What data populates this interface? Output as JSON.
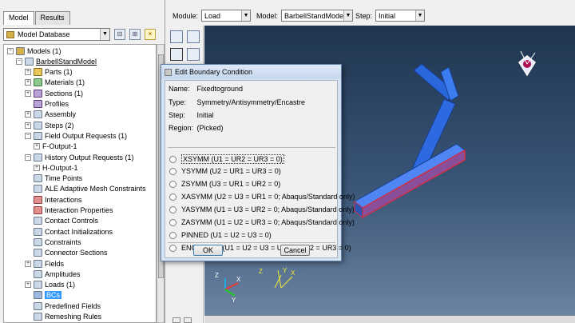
{
  "tabs": [
    "Model",
    "Results"
  ],
  "model_db": {
    "label": "Model Database"
  },
  "tree": [
    {
      "text": "Models (1)",
      "indent": 0,
      "icon": "db",
      "exp": "-"
    },
    {
      "text": "BarbellStandModel",
      "indent": 1,
      "icon": "",
      "exp": "-",
      "u": true
    },
    {
      "text": "Parts (1)",
      "indent": 2,
      "icon": "yellow",
      "exp": "+"
    },
    {
      "text": "Materials (1)",
      "indent": 2,
      "icon": "green",
      "exp": "+"
    },
    {
      "text": "Sections (1)",
      "indent": 2,
      "icon": "purple",
      "exp": "+"
    },
    {
      "text": "Profiles",
      "indent": 2,
      "icon": "purple",
      "exp": ""
    },
    {
      "text": "Assembly",
      "indent": 2,
      "icon": "",
      "exp": "+"
    },
    {
      "text": "Steps (2)",
      "indent": 2,
      "icon": "",
      "exp": "+"
    },
    {
      "text": "Field Output Requests (1)",
      "indent": 2,
      "icon": "",
      "exp": "-"
    },
    {
      "text": "F-Output-1",
      "indent": 3,
      "icon": "none",
      "exp": "+"
    },
    {
      "text": "History Output Requests (1)",
      "indent": 2,
      "icon": "",
      "exp": "-"
    },
    {
      "text": "H-Output-1",
      "indent": 3,
      "icon": "none",
      "exp": "+"
    },
    {
      "text": "Time Points",
      "indent": 2,
      "icon": "",
      "exp": ""
    },
    {
      "text": "ALE Adaptive Mesh Constraints",
      "indent": 2,
      "icon": "",
      "exp": ""
    },
    {
      "text": "Interactions",
      "indent": 2,
      "icon": "red",
      "exp": ""
    },
    {
      "text": "Interaction Properties",
      "indent": 2,
      "icon": "red",
      "exp": ""
    },
    {
      "text": "Contact Controls",
      "indent": 2,
      "icon": "",
      "exp": ""
    },
    {
      "text": "Contact Initializations",
      "indent": 2,
      "icon": "",
      "exp": ""
    },
    {
      "text": "Constraints",
      "indent": 2,
      "icon": "",
      "exp": ""
    },
    {
      "text": "Connector Sections",
      "indent": 2,
      "icon": "",
      "exp": ""
    },
    {
      "text": "Fields",
      "indent": 2,
      "icon": "",
      "exp": "+"
    },
    {
      "text": "Amplitudes",
      "indent": 2,
      "icon": "",
      "exp": ""
    },
    {
      "text": "Loads (1)",
      "indent": 2,
      "icon": "",
      "exp": "+"
    },
    {
      "text": "BCs",
      "indent": 2,
      "icon": "bc",
      "exp": "",
      "sel": true
    },
    {
      "text": "Predefined Fields",
      "indent": 2,
      "icon": "",
      "exp": ""
    },
    {
      "text": "Remeshing Rules",
      "indent": 2,
      "icon": "",
      "exp": ""
    }
  ],
  "context": {
    "module_label": "Module:",
    "module_value": "Load",
    "model_label": "Model:",
    "model_value": "BarbellStandModel",
    "step_label": "Step:",
    "step_value": "Initial"
  },
  "dialog": {
    "title": "Edit Boundary Condition",
    "name_key": "Name:",
    "name_value": "Fixedtoground",
    "type_key": "Type:",
    "type_value": "Symmetry/Antisymmetry/Encastre",
    "step_key": "Step:",
    "step_value": "Initial",
    "region_key": "Region:",
    "region_value": "(Picked)",
    "options": [
      "XSYMM (U1 = UR2 = UR3 = 0)",
      "YSYMM (U2 = UR1 = UR3 = 0)",
      "ZSYMM (U3 = UR1 = UR2 = 0)",
      "XASYMM (U2 = U3 = UR1 = 0; Abaqus/Standard only)",
      "YASYMM (U1 = U3 = UR2 = 0; Abaqus/Standard only)",
      "ZASYMM (U1 = U2 = UR3 = 0; Abaqus/Standard only)",
      "PINNED (U1 = U2 = U3 = 0)",
      "ENCASTRE (U1 = U2 = U3 = UR1 = UR2 = UR3 = 0)"
    ],
    "ok_label": "OK",
    "cancel_label": "Cancel"
  },
  "triad": {
    "x": "X",
    "y": "Y",
    "z": "Z"
  },
  "colors": {
    "viewport_top": "#1f3550",
    "part_blue": "#2f6fe0",
    "highlight_red": "#d0304a"
  }
}
